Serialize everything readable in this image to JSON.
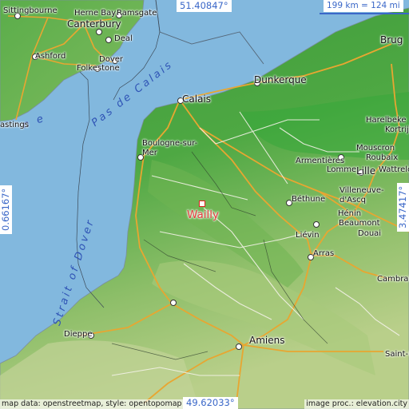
{
  "map": {
    "place": {
      "name": "Wailly"
    },
    "coordinates": {
      "north": "51.40847°",
      "south": "49.62033°",
      "west": "0.66167°",
      "east": "3.47417°"
    },
    "scale": "199 km = 124 mi",
    "credits": {
      "left": "map data: openstreetmap, style: opentopomap",
      "right": "image proc.: elevation.city"
    },
    "sea_labels": {
      "channel_fragment": "n    e",
      "pas_de_calais": "Pas de Calais",
      "strait_of_dover": "Strait of Dover"
    },
    "cities": [
      {
        "name": "Sittingbourne"
      },
      {
        "name": "Herne Bay"
      },
      {
        "name": "Ramsgate"
      },
      {
        "name": "Canterbury"
      },
      {
        "name": "Deal"
      },
      {
        "name": "Ashford"
      },
      {
        "name": "Dover"
      },
      {
        "name": "Folkestone"
      },
      {
        "name": "astings"
      },
      {
        "name": "Calais"
      },
      {
        "name": "Dunkerque"
      },
      {
        "name": "Brug"
      },
      {
        "name": "Harelbeke"
      },
      {
        "name": "Kortrijk"
      },
      {
        "name": "Mouscron"
      },
      {
        "name": "Roubaix"
      },
      {
        "name": "Armentières"
      },
      {
        "name": "Lomme"
      },
      {
        "name": "Lille"
      },
      {
        "name": "Wattrelos"
      },
      {
        "name": "Boulogne-sur-Mer"
      },
      {
        "name": "Béthune"
      },
      {
        "name": "Villeneuve-d'Ascq"
      },
      {
        "name": "Hénin"
      },
      {
        "name": "Beaumont"
      },
      {
        "name": "Liévin"
      },
      {
        "name": "Douai"
      },
      {
        "name": "Arras"
      },
      {
        "name": "Cambrai"
      },
      {
        "name": "Dieppe"
      },
      {
        "name": "Amiens"
      },
      {
        "name": "Saint-Q"
      }
    ]
  }
}
